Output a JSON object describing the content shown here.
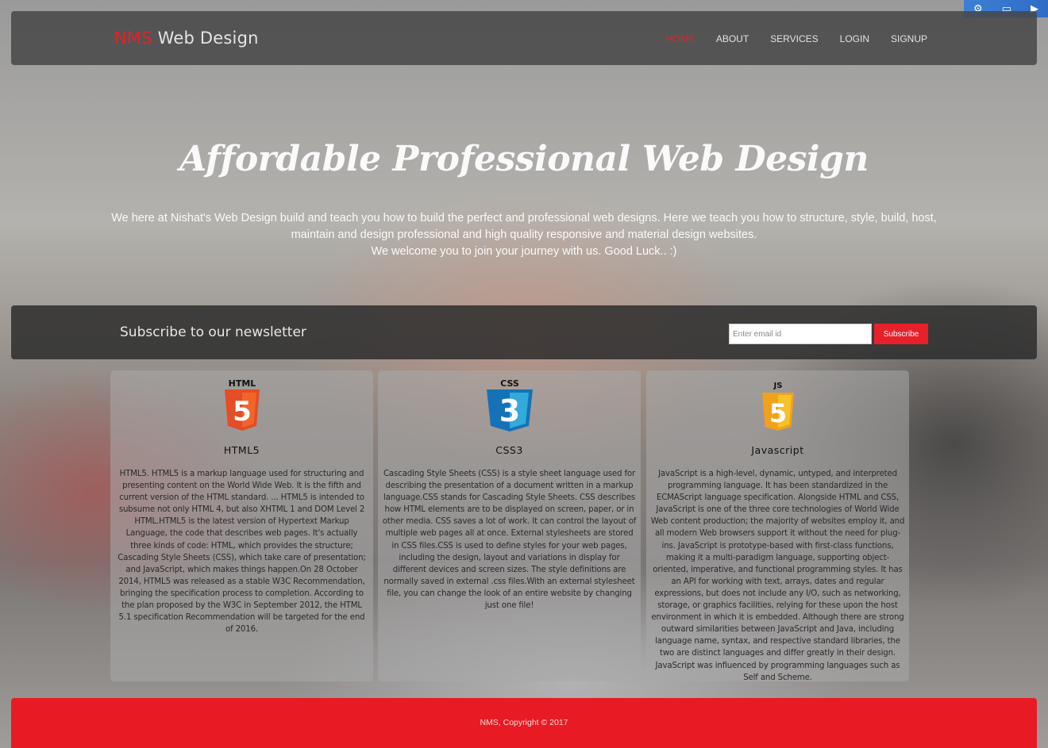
{
  "header": {
    "brand_accent": "NMS",
    "brand_rest": "Web Design",
    "nav": [
      {
        "label": "HOME"
      },
      {
        "label": "ABOUT"
      },
      {
        "label": "SERVICES"
      },
      {
        "label": "LOGIN"
      },
      {
        "label": "SIGNUP"
      }
    ],
    "active_nav": "HOME"
  },
  "hero": {
    "title": "Affordable Professional Web Design",
    "line1": "We here at Nishat's Web Design build and teach you how to build the perfect and professional web designs. Here we teach you how to structure, style, build, host, maintain and design professional and high quality responsive and material design websites.",
    "line2": "We welcome you to join your journey with us. Good Luck.. :)"
  },
  "newsletter": {
    "label": "Subscribe to our newsletter",
    "email_placeholder": "Enter email id",
    "button_label": "Subscribe"
  },
  "cards": [
    {
      "logo_label": "HTML",
      "logo_digit": "5",
      "title": "HTML5",
      "text": "HTML5. HTML5 is a markup language used for structuring and presenting content on the World Wide Web. It is the fifth and current version of the HTML standard. ... HTML5 is intended to subsume not only HTML 4, but also XHTML 1 and DOM Level 2 HTML.HTML5 is the latest version of Hypertext Markup Language, the code that describes web pages. It's actually three kinds of code: HTML, which provides the structure; Cascading Style Sheets (CSS), which take care of presentation; and JavaScript, which makes things happen.On 28 October 2014, HTML5 was released as a stable W3C Recommendation, bringing the specification process to completion. According to the plan proposed by the W3C in September 2012, the HTML 5.1 specification Recommendation will be targeted for the end of 2016."
    },
    {
      "logo_label": "CSS",
      "logo_digit": "3",
      "title": "CSS3",
      "text": "Cascading Style Sheets (CSS) is a style sheet language used for describing the presentation of a document written in a markup language.CSS stands for Cascading Style Sheets. CSS describes how HTML elements are to be displayed on screen, paper, or in other media. CSS saves a lot of work. It can control the layout of multiple web pages all at once. External stylesheets are stored in CSS files.CSS is used to define styles for your web pages, including the design, layout and variations in display for different devices and screen sizes. The style definitions are normally saved in external .css files.With an external stylesheet file, you can change the look of an entire website by changing just one file!"
    },
    {
      "logo_label": "JS",
      "logo_digit": "5",
      "title": "Javascript",
      "text": "JavaScript is a high-level, dynamic, untyped, and interpreted programming language. It has been standardized in the ECMAScript language specification. Alongside HTML and CSS, JavaScript is one of the three core technologies of World Wide Web content production; the majority of websites employ it, and all modern Web browsers support it without the need for plug-ins. JavaScript is prototype-based with first-class functions, making it a multi-paradigm language, supporting object-oriented, imperative, and functional programming styles. It has an API for working with text, arrays, dates and regular expressions, but does not include any I/O, such as networking, storage, or graphics facilities, relying for these upon the host environment in which it is embedded. Although there are strong outward similarities between JavaScript and Java, including language name, syntax, and respective standard libraries, the two are distinct languages and differ greatly in their design. JavaScript was influenced by programming languages such as Self and Scheme."
    }
  ],
  "footer": {
    "text": "NMS, Copyright © 2017"
  },
  "colors": {
    "accent": "#e8202a",
    "html5": "#e44d26",
    "css3": "#1572b6",
    "js": "#f0a21c"
  },
  "icons": {
    "html5": "html5-shield-icon",
    "css3": "css3-shield-icon",
    "js": "js-shield-icon"
  }
}
